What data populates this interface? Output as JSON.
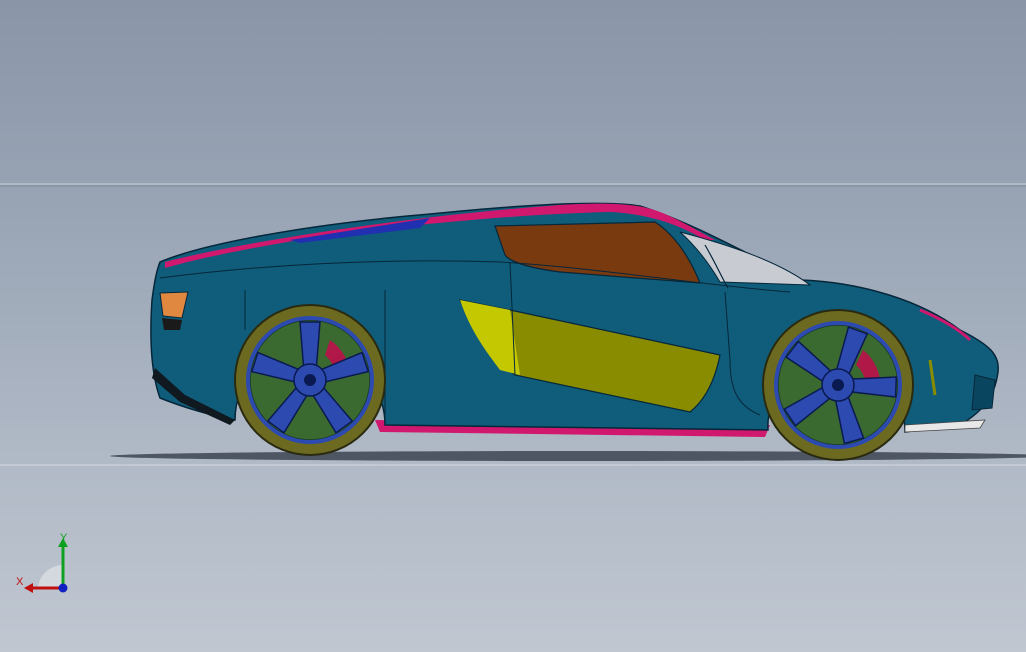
{
  "viewport": {
    "background_top": "#8a96a8",
    "background_bottom": "#c0c7d1"
  },
  "car": {
    "body_color": "#0f5d7a",
    "accent_color": "#d0186e",
    "window_color": "#7a3a10",
    "side_panel_color": "#8a8c00",
    "windshield_color": "#c8ccd2",
    "rim_color": "#2c4ab0",
    "tire_color": "#6c6a20",
    "caliper_color": "#b01848",
    "tail_light_color": "#e08840",
    "stripe_color": "#2030b0"
  },
  "triad": {
    "x_label": "X",
    "y_label": "Y",
    "x_color": "#c01010",
    "y_color": "#10a020",
    "z_color": "#1020c0",
    "icon": "coordinate-triad-icon"
  }
}
